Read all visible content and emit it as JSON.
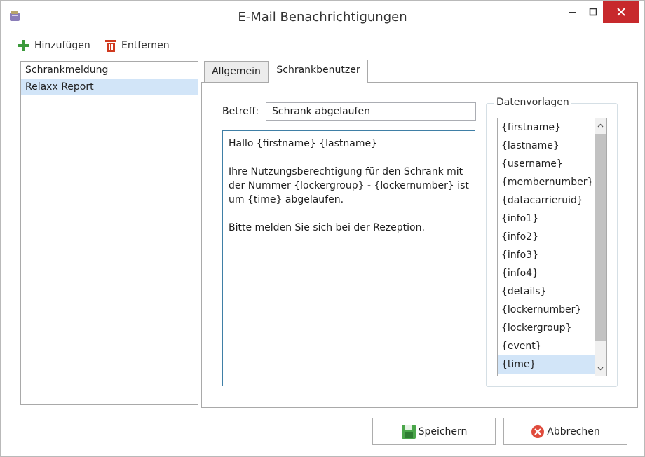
{
  "window": {
    "title": "E-Mail Benachrichtigungen"
  },
  "toolbar": {
    "add_label": "Hinzufügen",
    "remove_label": "Entfernen"
  },
  "notifications": [
    {
      "label": "Schrankmeldung",
      "selected": false
    },
    {
      "label": "Relaxx Report",
      "selected": true
    }
  ],
  "tabs": [
    {
      "label": "Allgemein",
      "active": false
    },
    {
      "label": "Schrankbenutzer",
      "active": true
    }
  ],
  "editor": {
    "subject_label": "Betreff:",
    "subject_value": "Schrank abgelaufen",
    "body_lines": [
      "Hallo {firstname} {lastname}",
      "",
      "Ihre Nutzungsberechtigung für den Schrank mit",
      "der Nummer {lockergroup} - {lockernumber} ist",
      "um {time} abgelaufen.",
      "",
      "Bitte melden Sie sich bei der Rezeption."
    ]
  },
  "templates": {
    "title": "Datenvorlagen",
    "items": [
      "{firstname}",
      "{lastname}",
      "{username}",
      "{membernumber}",
      "{datacarrieruid}",
      "{info1}",
      "{info2}",
      "{info3}",
      "{info4}",
      "{details}",
      "{lockernumber}",
      "{lockergroup}",
      "{event}",
      "{time}"
    ],
    "selected": "{time}"
  },
  "buttons": {
    "save_label": "Speichern",
    "cancel_label": "Abbrechen"
  },
  "colors": {
    "close_button": "#c7292c",
    "selection": "#d2e5f8",
    "add_icon": "#3c9a3c",
    "remove_icon": "#d03a1f",
    "save_icon": "#4aa64a",
    "cancel_icon": "#e04b3c"
  }
}
